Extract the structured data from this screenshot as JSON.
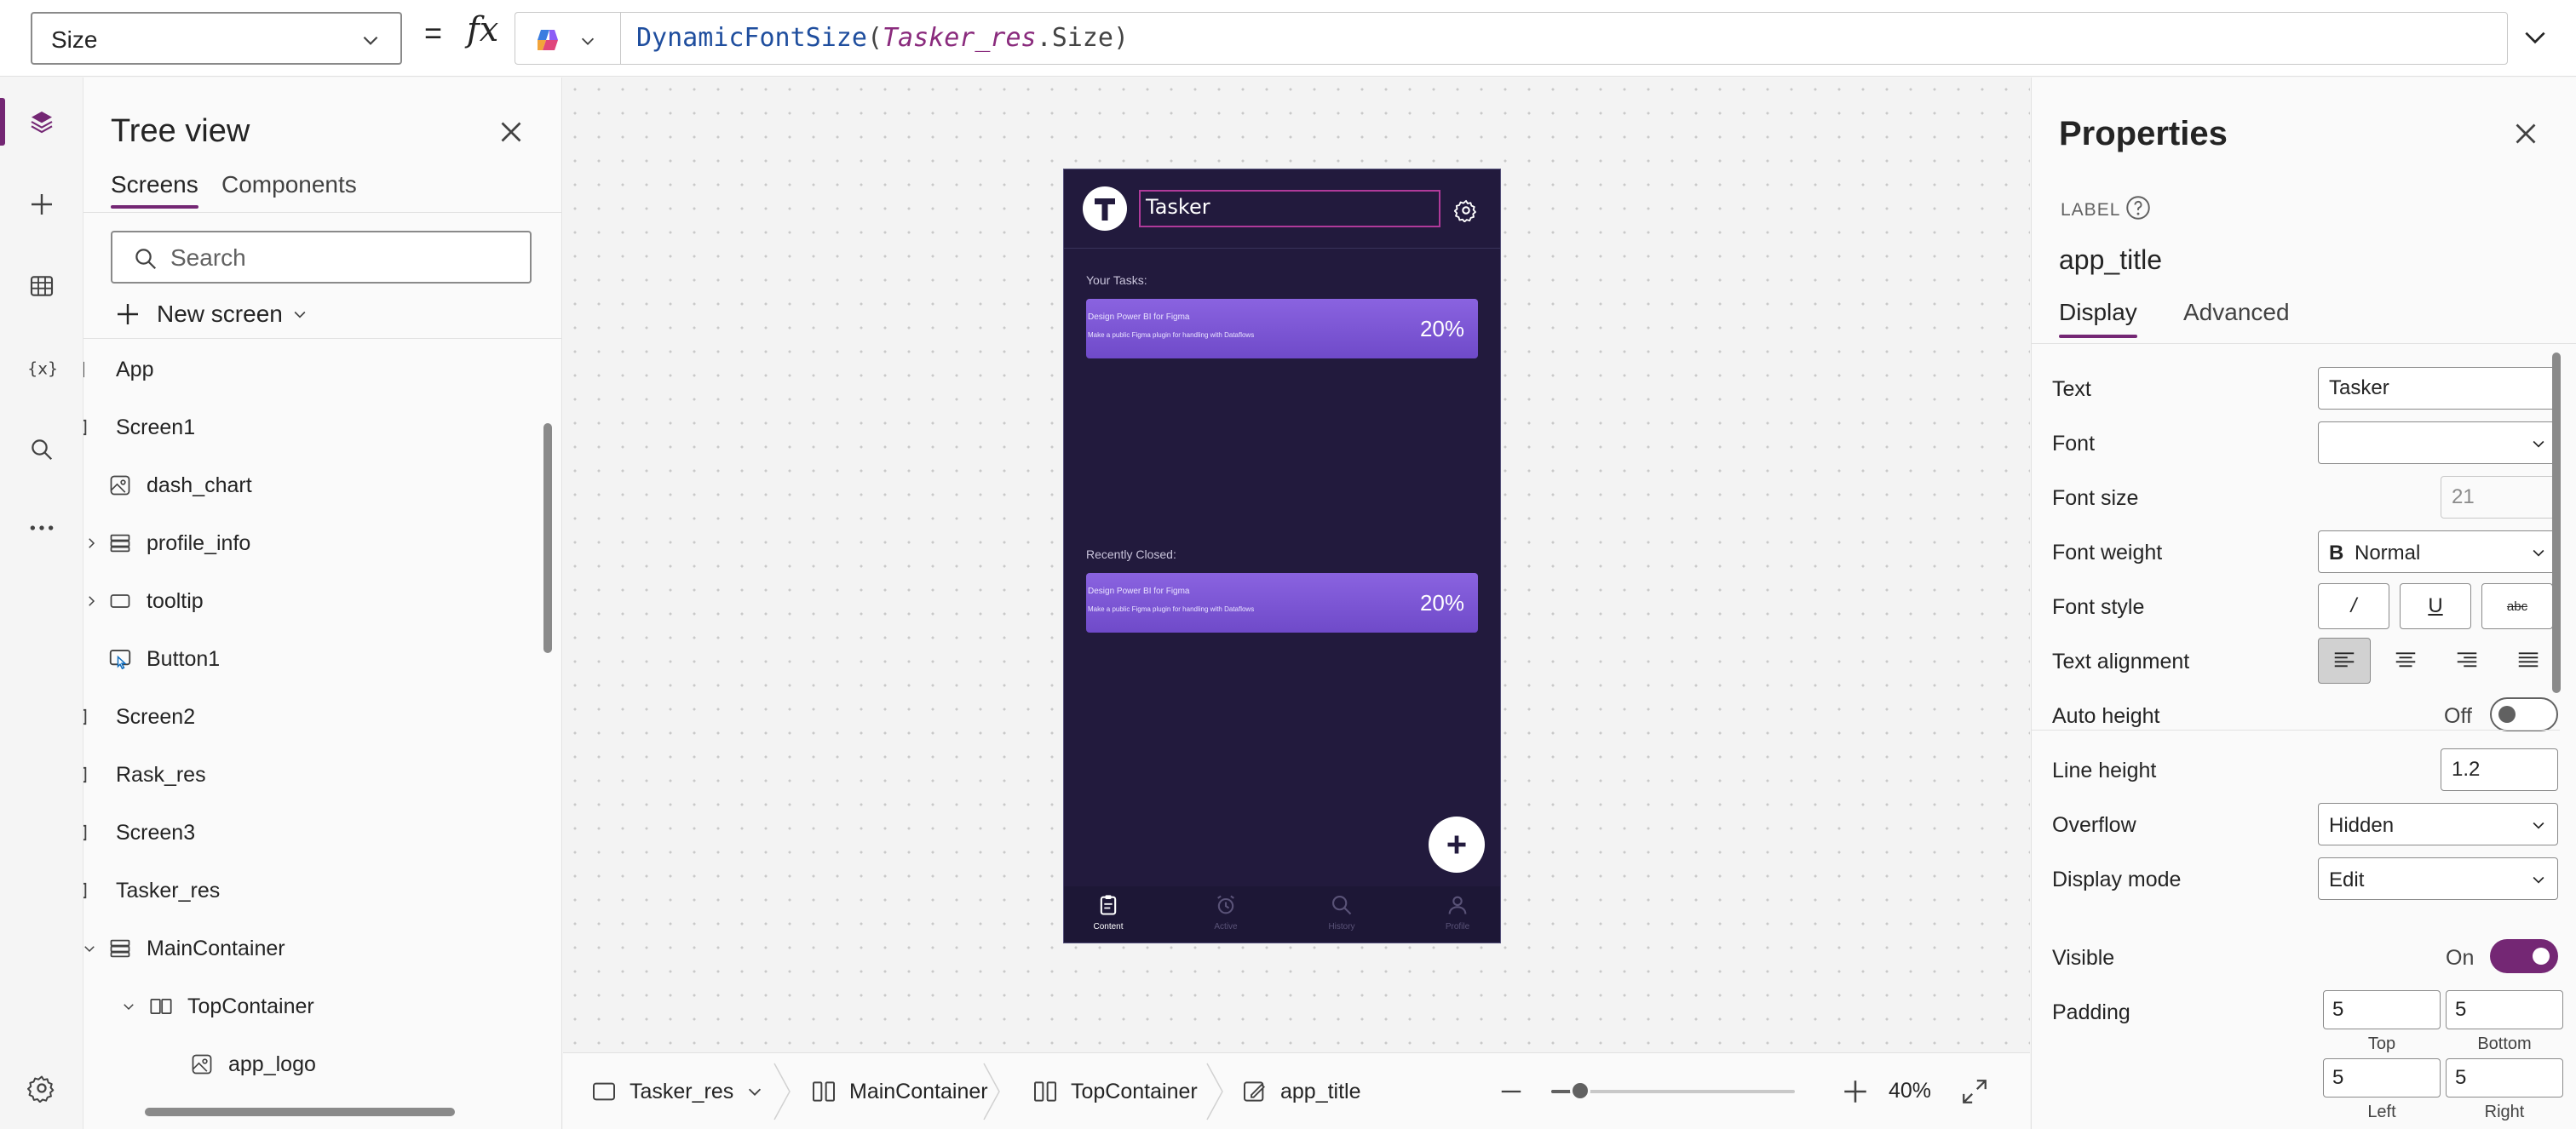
{
  "formula_bar": {
    "property": "Size",
    "equals": "=",
    "fx": "fx",
    "formula_fn": "DynamicFontSize",
    "formula_open": "(",
    "formula_arg": "Tasker_res",
    "formula_dot": ".",
    "formula_prop": "Size",
    "formula_close": ")"
  },
  "left_rail": {
    "items": [
      "layers-icon",
      "plus-icon",
      "grid-icon",
      "variables-icon",
      "search-icon",
      "more-icon"
    ],
    "bottom": "gear-icon",
    "active_index": 0
  },
  "tree_view": {
    "title": "Tree view",
    "tabs": [
      "Screens",
      "Components"
    ],
    "active_tab": 0,
    "search_placeholder": "Search",
    "new_screen_label": "New screen",
    "nodes": [
      {
        "label": "App",
        "icon": "app-icon"
      },
      {
        "label": "Screen1",
        "icon": "screen-icon"
      },
      {
        "label": "dash_chart",
        "icon": "image-icon"
      },
      {
        "label": "profile_info",
        "icon": "container-icon"
      },
      {
        "label": "tooltip",
        "icon": "rectangle-icon"
      },
      {
        "label": "Button1",
        "icon": "button-icon"
      },
      {
        "label": "Screen2",
        "icon": "screen-icon"
      },
      {
        "label": "Rask_res",
        "icon": "screen-icon"
      },
      {
        "label": "Screen3",
        "icon": "screen-icon"
      },
      {
        "label": "Tasker_res",
        "icon": "screen-icon"
      },
      {
        "label": "MainContainer",
        "icon": "container-icon"
      },
      {
        "label": "TopContainer",
        "icon": "horizontal-container-icon"
      },
      {
        "label": "app_logo",
        "icon": "image-icon"
      }
    ]
  },
  "phone": {
    "title_value": "Tasker",
    "your_tasks": "Your Tasks:",
    "recently_closed": "Recently Closed:",
    "card_title": "Design Power BI for Figma",
    "card_subtitle": "Make a public Figma plugin for handling with Dataflows",
    "card_percent": "20%",
    "nav": [
      "Content",
      "Active",
      "History",
      "Profile"
    ],
    "accent": "#7b55d6",
    "background": "#221a3d"
  },
  "status_bar": {
    "crumbs": [
      "Tasker_res",
      "MainContainer",
      "TopContainer",
      "app_title"
    ],
    "zoom_level": "40%",
    "zoom_fraction": 0.12
  },
  "properties": {
    "title": "Properties",
    "control_type": "LABEL",
    "control_name": "app_title",
    "tabs": [
      "Display",
      "Advanced"
    ],
    "active_tab": 0,
    "text_label": "Text",
    "text_value": "Tasker",
    "font_label": "Font",
    "font_value": "",
    "font_size_label": "Font size",
    "font_size_value": "21",
    "font_weight_label": "Font weight",
    "font_weight_icon": "B",
    "font_weight_value": "Normal",
    "font_style_label": "Font style",
    "font_style_buttons": [
      "/",
      "U",
      "abc"
    ],
    "text_alignment_label": "Text alignment",
    "auto_height_label": "Auto height",
    "auto_height_state": "Off",
    "line_height_label": "Line height",
    "line_height_value": "1.2",
    "overflow_label": "Overflow",
    "overflow_value": "Hidden",
    "display_mode_label": "Display mode",
    "display_mode_value": "Edit",
    "visible_label": "Visible",
    "visible_state": "On",
    "padding_label": "Padding",
    "padding_top": "5",
    "padding_bottom": "5",
    "padding_left": "5",
    "padding_right": "5",
    "padding_top_caption": "Top",
    "padding_bottom_caption": "Bottom",
    "padding_left_caption": "Left",
    "padding_right_caption": "Right",
    "accent": "#742774"
  }
}
